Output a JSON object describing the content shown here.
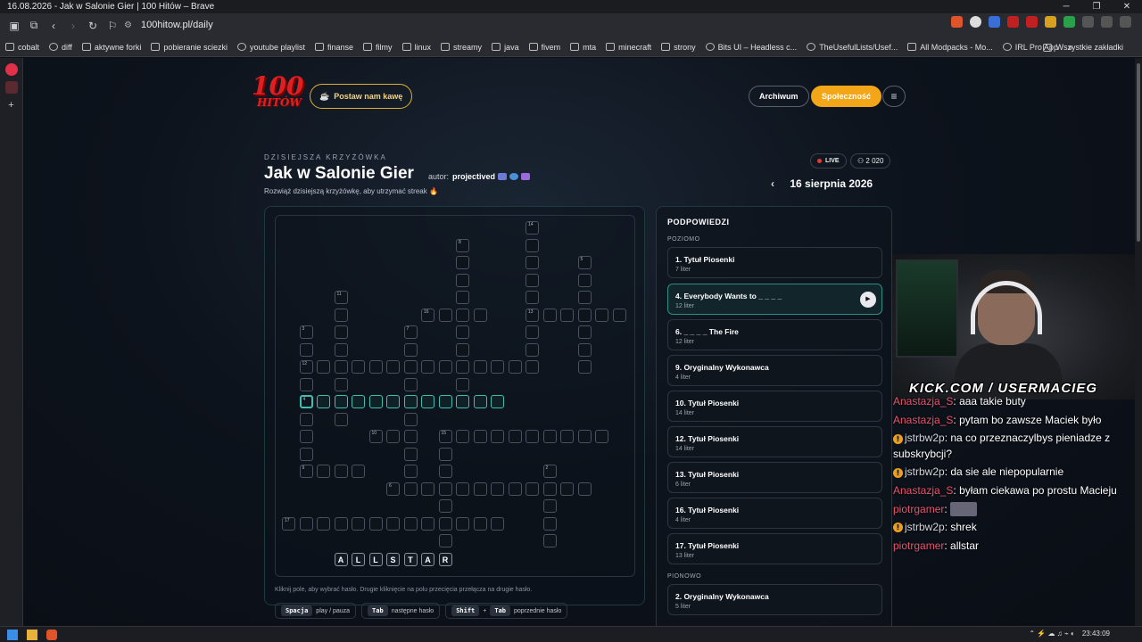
{
  "browser": {
    "window_title": "16.08.2026 - Jak w Salonie Gier | 100 Hitów – Brave",
    "url": "100hitow.pl/daily",
    "bookmarks": [
      "cobalt",
      "diff",
      "aktywne forki",
      "pobieranie sciezki",
      "youtube playlist",
      "finanse",
      "filmy",
      "linux",
      "streamy",
      "java",
      "fivem",
      "mta",
      "minecraft",
      "strony",
      "Bits UI – Headless c...",
      "TheUsefulLists/Usef...",
      "All Modpacks - Mo...",
      "IRL Pro App"
    ],
    "bookmarks_all": "Wszystkie zakładki"
  },
  "header": {
    "logo_number": "100",
    "logo_text": "HITÓW",
    "coffee_label": "Postaw nam kawę",
    "archiwum": "Archiwum",
    "spolecznosc": "Społeczność"
  },
  "puzzle": {
    "kicker": "DZISIEJSZA KRZYŻÓWKA",
    "title": "Jak w Salonie Gier",
    "author_label": "autor:",
    "author": "projectived",
    "subtitle": "Rozwiąż dzisiejszą krzyżówkę, aby utrzymać streak 🔥",
    "live": "LIVE",
    "players": "2 020",
    "date": "16 sierpnia 2026",
    "typed_letters": [
      "A",
      "L",
      "L",
      "S",
      "T",
      "A",
      "R"
    ]
  },
  "help": {
    "hint": "Kliknij pole, aby wybrać hasło. Drugie kliknięcie na polu przecięcia przełącza na drugie hasło.",
    "k1": "Spacja",
    "k1_desc": "play / pauza",
    "k2": "Tab",
    "k2_desc": "następne hasło",
    "k3a": "Shift",
    "k3_plus": "+",
    "k3b": "Tab",
    "k3_desc": "poprzednie hasło"
  },
  "clues": {
    "heading": "PODPOWIEDZI",
    "across_label": "POZIOMO",
    "down_label": "PIONOWO",
    "across": [
      {
        "title": "1. Tytuł Piosenki",
        "len": "7 liter"
      },
      {
        "title": "4. Everybody Wants to _ _ _ _",
        "len": "12 liter"
      },
      {
        "title": "6. _ _ _ _ The Fire",
        "len": "12 liter"
      },
      {
        "title": "9. Oryginalny Wykonawca",
        "len": "4 liter"
      },
      {
        "title": "10. Tytuł Piosenki",
        "len": "14 liter"
      },
      {
        "title": "12. Tytuł Piosenki",
        "len": "14 liter"
      },
      {
        "title": "13. Tytuł Piosenki",
        "len": "6 liter"
      },
      {
        "title": "16. Tytuł Piosenki",
        "len": "4 liter"
      },
      {
        "title": "17. Tytuł Piosenki",
        "len": "13 liter"
      }
    ],
    "down": [
      {
        "title": "2. Oryginalny Wykonawca",
        "len": "5 liter"
      }
    ]
  },
  "stream": {
    "overlay": "KICK.COM / USERMACIEG",
    "chat": [
      {
        "user": "Anastazja_S",
        "text": "aaa takie buty"
      },
      {
        "user": "Anastazja_S",
        "text": "pytam bo zawsze Maciek było"
      },
      {
        "user": "jstrbw2p",
        "text": "na co przeznaczylbys pieniadze z subskrybcji?",
        "badge": true
      },
      {
        "user": "jstrbw2p",
        "text": "da sie ale niepopularnie",
        "badge": true
      },
      {
        "user": "Anastazja_S",
        "text": "byłam ciekawa po prostu Macieju"
      },
      {
        "user": "piotrgamer",
        "text": "",
        "emote": true
      },
      {
        "user": "jstrbw2p",
        "text": "shrek",
        "badge": true
      },
      {
        "user": "piotrgamer",
        "text": "allstar"
      }
    ]
  },
  "taskbar": {
    "time": "23:43:09"
  },
  "colors": {
    "accent": "#f2a618",
    "teal": "#3fbfb0",
    "live": "#e23a3a",
    "brand": "#e02020"
  }
}
